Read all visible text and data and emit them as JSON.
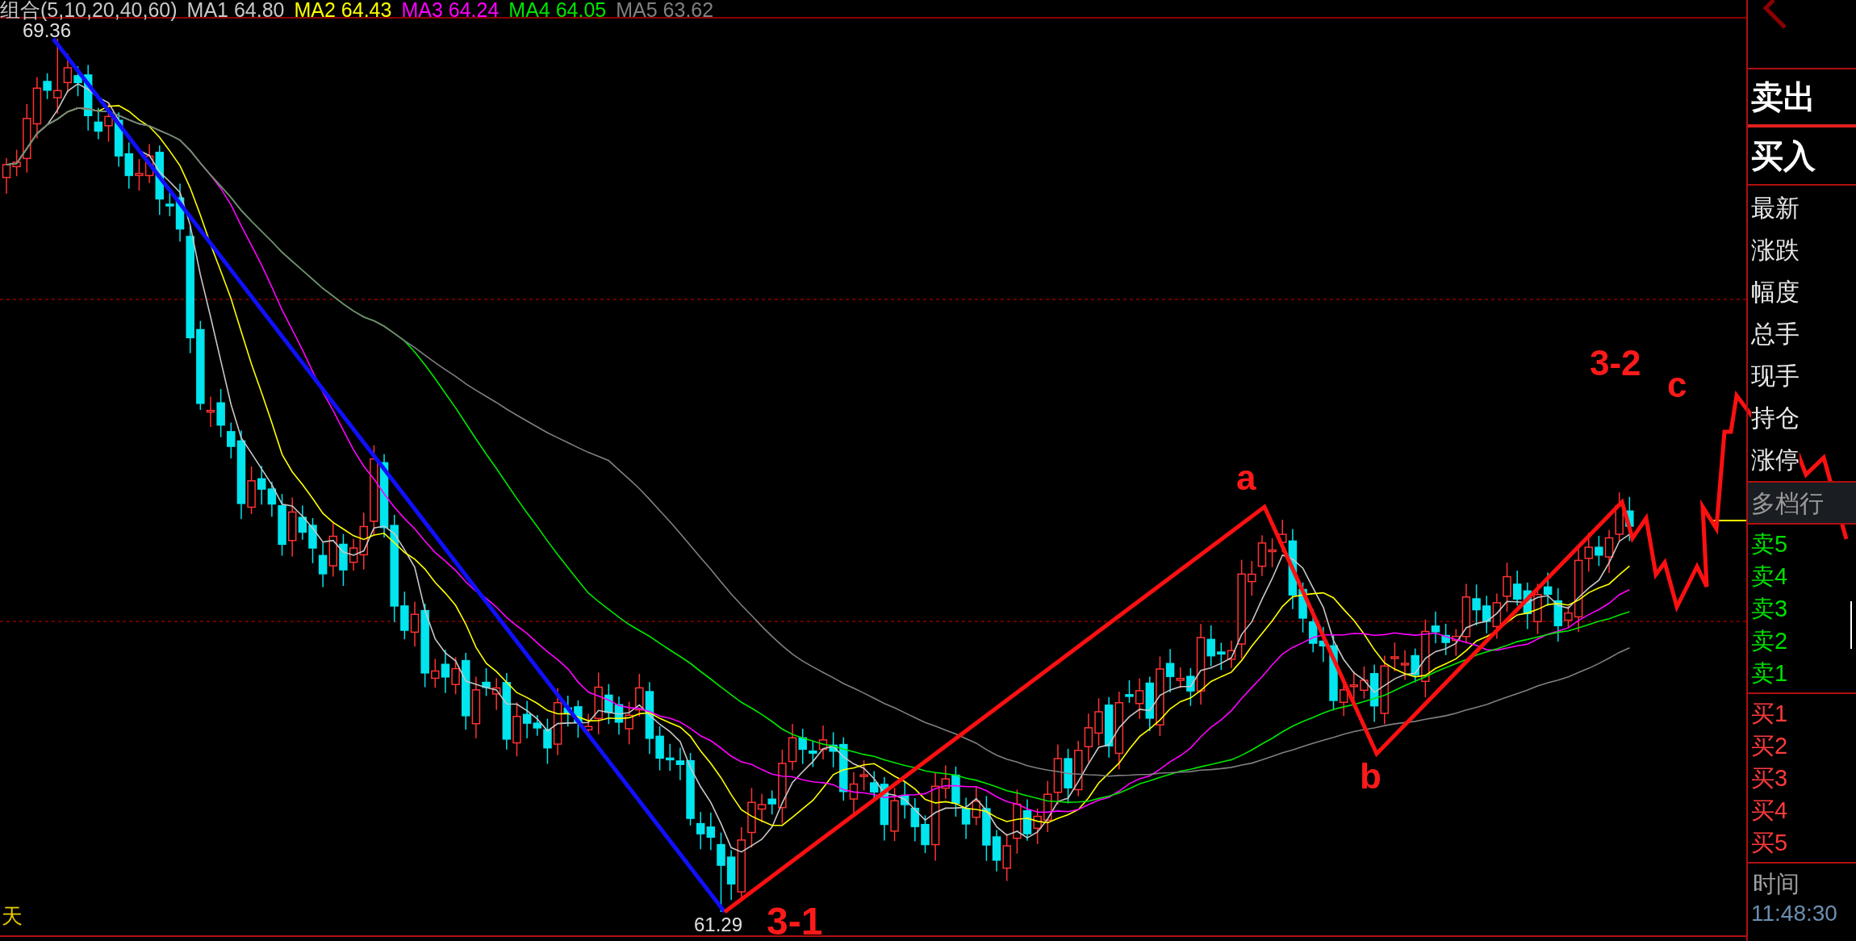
{
  "chart": {
    "indicator_title": "组合(5,10,20,40,60)",
    "moving_averages": [
      {
        "label": "MA1 64.80",
        "color": "#c8c8c8"
      },
      {
        "label": "MA2 64.43",
        "color": "#ffff00"
      },
      {
        "label": "MA3 64.24",
        "color": "#ff00ff"
      },
      {
        "label": "MA4 64.05",
        "color": "#00e600"
      },
      {
        "label": "MA5 63.62",
        "color": "#808080"
      }
    ],
    "high_label": "69.36",
    "low_label": "61.29",
    "period_label": "天",
    "annotations": [
      {
        "text": "3-1"
      },
      {
        "text": "a"
      },
      {
        "text": "b"
      },
      {
        "text": "3-2"
      },
      {
        "text": "c"
      }
    ]
  },
  "panel": {
    "trade_buttons": [
      "卖出",
      "买入"
    ],
    "quote_fields": [
      "最新",
      "涨跌",
      "幅度",
      "总手",
      "现手",
      "持仓",
      "涨停"
    ],
    "depth_tab": "多档行",
    "asks": [
      "卖5",
      "卖4",
      "卖3",
      "卖2",
      "卖1"
    ],
    "bids": [
      "买1",
      "买2",
      "买3",
      "买4",
      "买5"
    ],
    "time_label": "时间",
    "time": "11:48:30"
  }
}
